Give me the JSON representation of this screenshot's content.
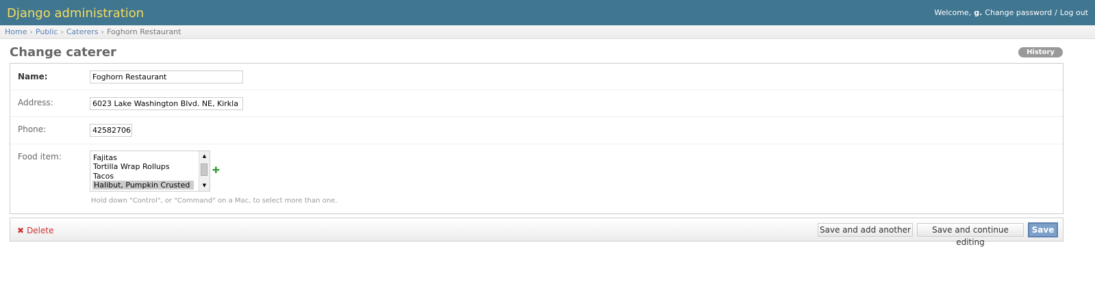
{
  "header": {
    "branding": "Django administration",
    "welcome": "Welcome,",
    "username": "g.",
    "change_password": "Change password",
    "separator": "/",
    "logout": "Log out"
  },
  "breadcrumbs": {
    "items": [
      "Home",
      "Public",
      "Caterers"
    ],
    "separator": "›",
    "current": "Foghorn Restaurant"
  },
  "page": {
    "title": "Change caterer",
    "history_label": "History"
  },
  "form": {
    "name": {
      "label": "Name:",
      "value": "Foghorn Restaurant"
    },
    "address": {
      "label": "Address:",
      "value": "6023 Lake Washington Blvd. NE, Kirkla"
    },
    "phone": {
      "label": "Phone:",
      "value": "42582706"
    },
    "food_item": {
      "label": "Food item:",
      "options": [
        "Fajitas",
        "Tortilla Wrap Rollups",
        "Tacos",
        "Halibut, Pumpkin Crusted"
      ],
      "selected": "Halibut, Pumpkin Crusted",
      "add_icon": "plus-icon",
      "help_text": "Hold down \"Control\", or \"Command\" on a Mac, to select more than one."
    }
  },
  "submit": {
    "delete_icon": "x-icon",
    "delete_label": "Delete",
    "save_add_another": "Save and add another",
    "save_continue": "Save and continue editing",
    "save": "Save"
  },
  "colors": {
    "header_bg": "#417690",
    "branding": "#f5dd5d",
    "link": "#5b80b2",
    "delete": "#cc3333",
    "save_button": "#7ca0c7"
  }
}
